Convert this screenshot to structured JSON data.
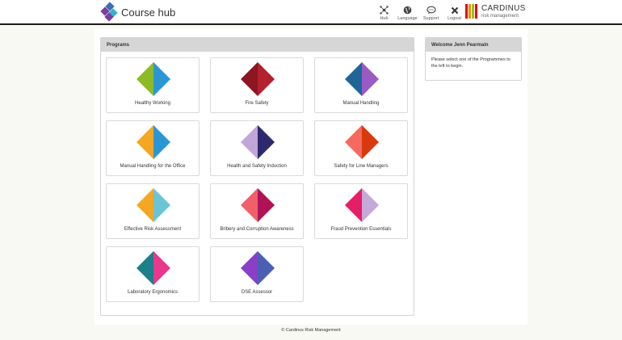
{
  "header": {
    "app_title": "Course hub",
    "nav": [
      {
        "label": "Hub",
        "icon": "hub-icon"
      },
      {
        "label": "Language",
        "icon": "globe-icon"
      },
      {
        "label": "Support",
        "icon": "chat-bubble-icon"
      },
      {
        "label": "Logout",
        "icon": "close-icon"
      }
    ],
    "company_name": "CARDINUS",
    "company_sub": "risk management"
  },
  "programs": {
    "title": "Programs",
    "items": [
      {
        "label": "Healthy Working",
        "left_color": "#8dbb25",
        "right_color": "#2a97d4"
      },
      {
        "label": "Fire Safety",
        "left_color": "#8c1622",
        "right_color": "#b3202e"
      },
      {
        "label": "Manual Handling",
        "left_color": "#1f6597",
        "right_color": "#9b59c4"
      },
      {
        "label": "Manual Handling for the Office",
        "left_color": "#f5a623",
        "right_color": "#2a97d4"
      },
      {
        "label": "Health and Safety Induction",
        "left_color": "#c1a6d9",
        "right_color": "#2c2a6e"
      },
      {
        "label": "Safety for Line Managers",
        "left_color": "#f46a5e",
        "right_color": "#d83a0e"
      },
      {
        "label": "Effective Risk Assessment",
        "left_color": "#f5a623",
        "right_color": "#6ac4d4"
      },
      {
        "label": "Bribery and Corruption Awareness",
        "left_color": "#f0606a",
        "right_color": "#b01256"
      },
      {
        "label": "Fraud Prevention Essentials",
        "left_color": "#e41f66",
        "right_color": "#c5a9d9"
      },
      {
        "label": "Laboratory Ergonomics",
        "left_color": "#1b7f8c",
        "right_color": "#e7388b"
      },
      {
        "label": "DSE Assessor",
        "left_color": "#8a3fc4",
        "right_color": "#4b5fb4"
      }
    ]
  },
  "welcome": {
    "title": "Welcome Jenn Pearmain",
    "message": "Please select one of the Programmes to the left to begin."
  },
  "footer": {
    "text": "© Cardinus Risk Management"
  },
  "colors": {
    "header_border": "#1c1c1c",
    "panel_header": "#d6d6d6",
    "page_background": "#f9f9f4"
  }
}
